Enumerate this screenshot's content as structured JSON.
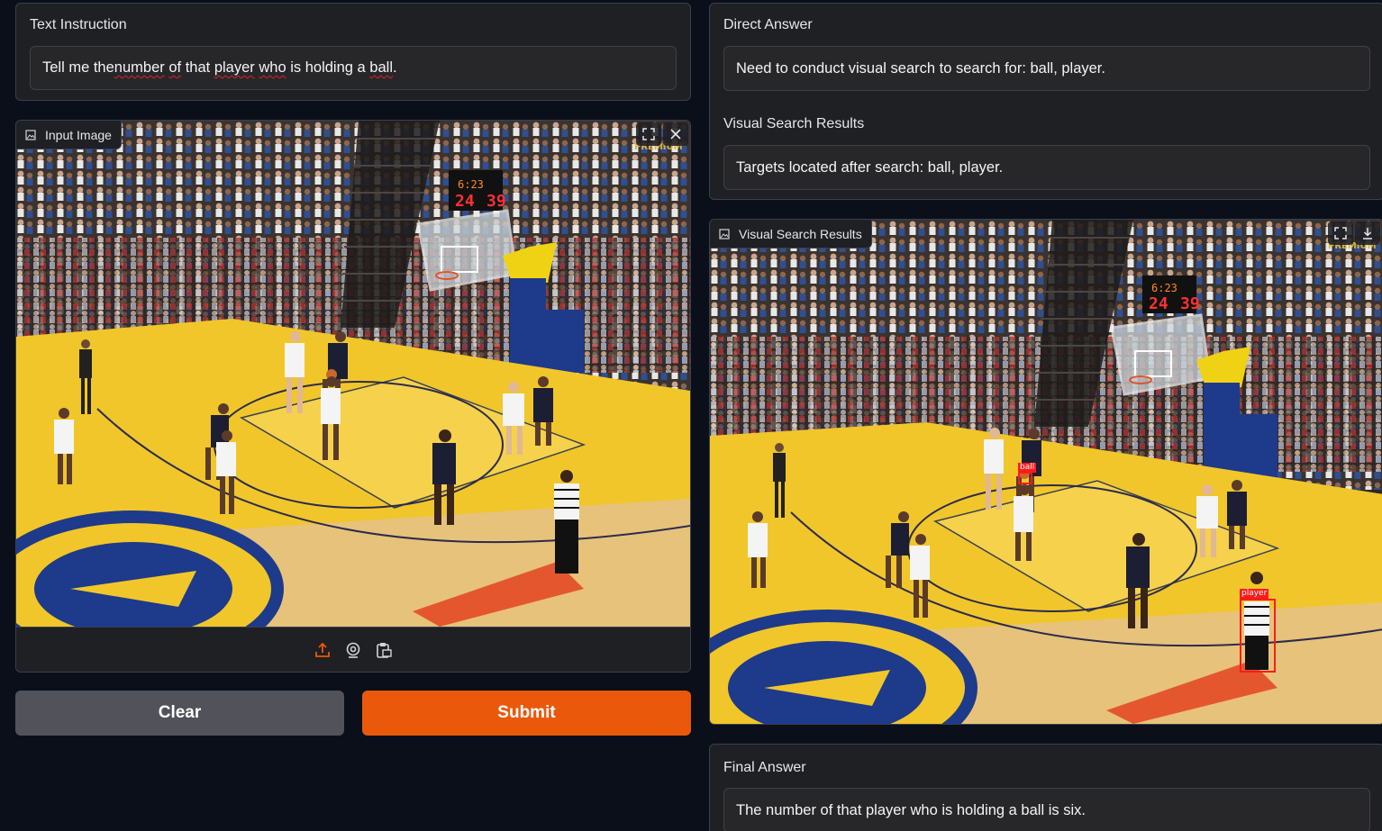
{
  "text_instruction": {
    "label": "Text Instruction",
    "value_parts": [
      "Tell me the ",
      "number",
      " ",
      "of",
      " that ",
      "player",
      " ",
      "who",
      " is holding a ",
      "ball",
      "."
    ]
  },
  "input_image": {
    "label": "Input Image",
    "icons": [
      "fullscreen-icon",
      "close-icon",
      "upload-icon",
      "webcam-icon",
      "clipboard-icon"
    ]
  },
  "buttons": {
    "clear": "Clear",
    "submit": "Submit"
  },
  "direct_answer": {
    "label": "Direct Answer",
    "value": "Need to conduct visual search to search for: ball, player."
  },
  "visual_search_text": {
    "label": "Visual Search Results",
    "value": "Targets located after search: ball, player."
  },
  "visual_search_image": {
    "label": "Visual Search Results",
    "icons": [
      "fullscreen-icon",
      "download-icon"
    ],
    "detections": [
      {
        "label": "ball"
      },
      {
        "label": "player"
      }
    ]
  },
  "final_answer": {
    "label": "Final Answer",
    "value": "The number of that player who is holding a ball is six."
  },
  "scoreboard": {
    "time": "6:23",
    "shot": "24",
    "side": "39"
  },
  "watermark": "PREMIUM",
  "colors": {
    "page_bg": "#0b0f19",
    "panel_bg": "#1f2023",
    "accent_orange": "#ea580c",
    "clear_gray": "#52525b",
    "detection_red": "#ff1a1a",
    "court_yellow": "#f1c62a"
  }
}
